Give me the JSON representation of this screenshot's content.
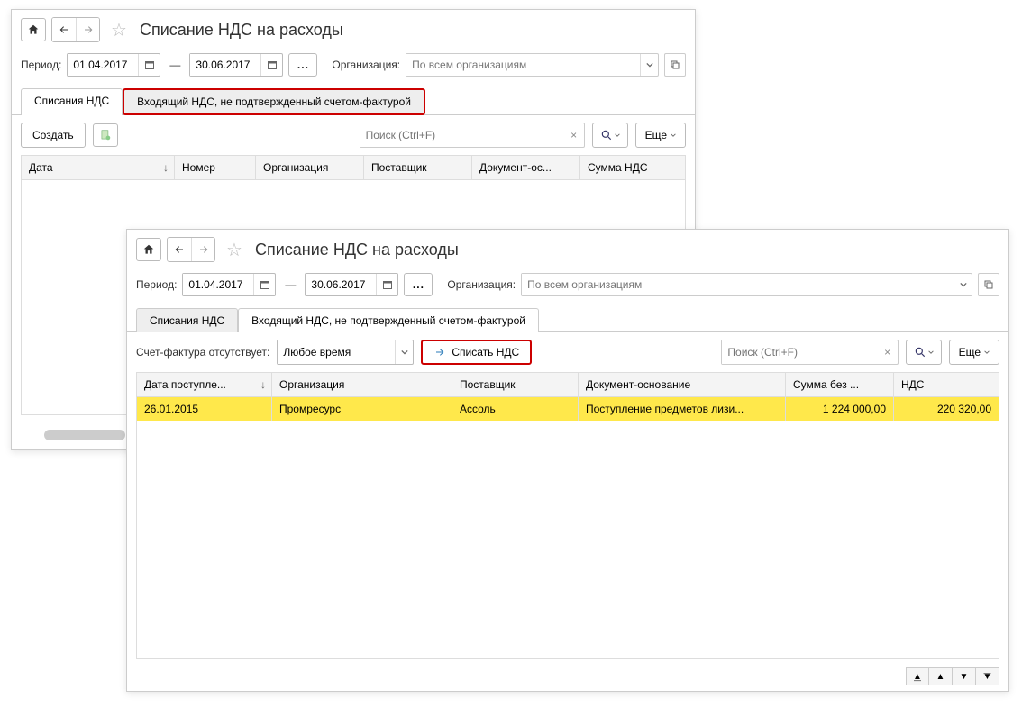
{
  "win1": {
    "title": "Списание НДС на расходы",
    "period_label": "Период:",
    "date_from": "01.04.2017",
    "date_to": "30.06.2017",
    "org_label": "Организация:",
    "org_placeholder": "По всем организациям",
    "tabs": {
      "t1": "Списания НДС",
      "t2": "Входящий НДС, не подтвержденный счетом-фактурой"
    },
    "create_btn": "Создать",
    "search_placeholder": "Поиск (Ctrl+F)",
    "more_btn": "Еще",
    "columns": {
      "c1": "Дата",
      "c2": "Номер",
      "c3": "Организация",
      "c4": "Поставщик",
      "c5": "Документ-ос...",
      "c6": "Сумма НДС"
    }
  },
  "win2": {
    "title": "Списание НДС на расходы",
    "period_label": "Период:",
    "date_from": "01.04.2017",
    "date_to": "30.06.2017",
    "org_label": "Организация:",
    "org_placeholder": "По всем организациям",
    "tabs": {
      "t1": "Списания НДС",
      "t2": "Входящий НДС, не подтвержденный счетом-фактурой"
    },
    "sf_label": "Счет-фактура отсутствует:",
    "sf_value": "Любое время",
    "writeoff_btn": "Списать НДС",
    "search_placeholder": "Поиск (Ctrl+F)",
    "more_btn": "Еще",
    "columns": {
      "c1": "Дата поступле...",
      "c2": "Организация",
      "c3": "Поставщик",
      "c4": "Документ-основание",
      "c5": "Сумма без ...",
      "c6": "НДС"
    },
    "row": {
      "c1": "26.01.2015",
      "c2": "Промресурс",
      "c3": "Ассоль",
      "c4": "Поступление предметов лизи...",
      "c5": "1 224 000,00",
      "c6": "220 320,00"
    }
  }
}
